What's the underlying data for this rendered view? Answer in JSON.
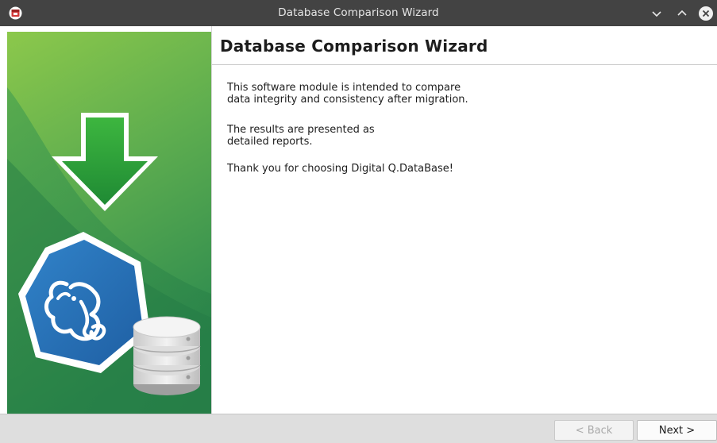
{
  "window": {
    "title": "Database Comparison Wizard",
    "controls": [
      "minimize",
      "maximize",
      "close"
    ]
  },
  "wizard": {
    "heading": "Database Comparison Wizard",
    "paragraphs": [
      "This software module is intended to compare\ndata integrity and consistency after migration.",
      "The results are presented as\ndetailed reports.",
      "Thank you for choosing Digital Q.DataBase!"
    ]
  },
  "buttons": {
    "back_label": "< Back",
    "next_label": "Next >"
  },
  "sidebar": {
    "icons": [
      "download-arrow-icon",
      "elephant-logo-icon",
      "database-stack-icon"
    ]
  },
  "colors": {
    "sidebar_green_dark": "#2f8b4b",
    "sidebar_green_light": "#7cc150",
    "arrow_green": "#2fa23b",
    "logo_blue": "#2a6fb5",
    "titlebar": "#434343"
  }
}
